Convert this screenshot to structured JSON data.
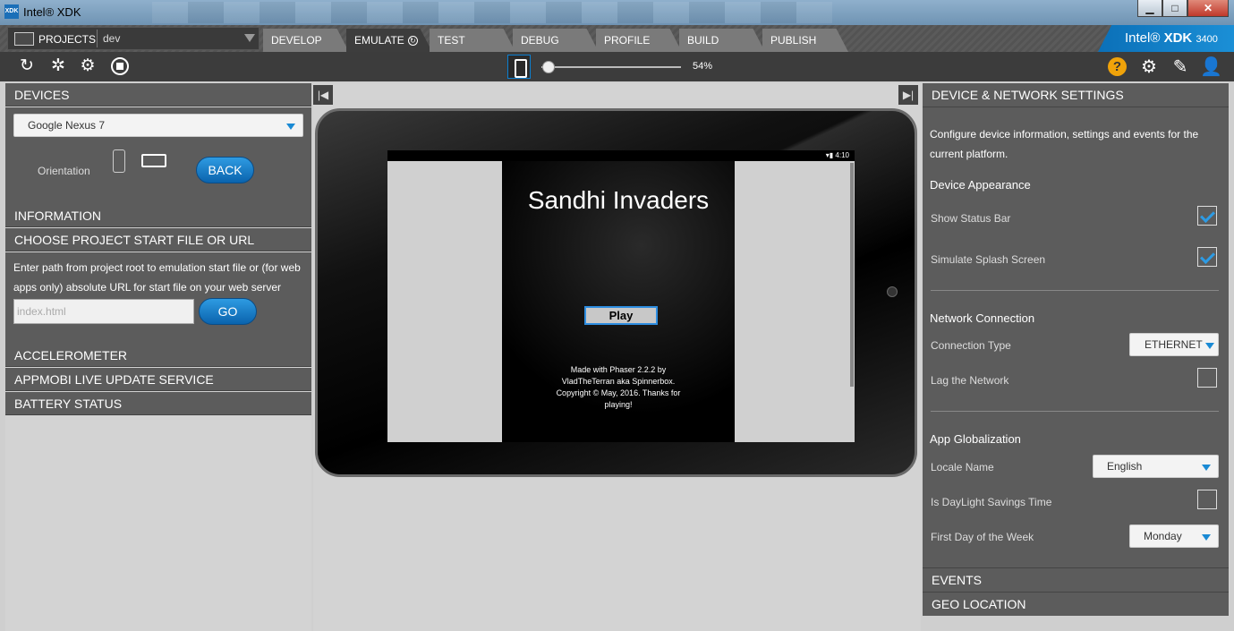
{
  "window": {
    "title": "Intel® XDK",
    "logo_text": "XDK",
    "minimize": "▁",
    "maximize": "□",
    "close": "✕"
  },
  "projects": {
    "label": "PROJECTS",
    "value": "dev"
  },
  "tabs": [
    {
      "label": "DEVELOP"
    },
    {
      "label": "EMULATE"
    },
    {
      "label": "TEST"
    },
    {
      "label": "DEBUG"
    },
    {
      "label": "PROFILE"
    },
    {
      "label": "BUILD"
    },
    {
      "label": "PUBLISH"
    }
  ],
  "brand": {
    "prefix": "Intel",
    "name": "XDK",
    "build": "3400"
  },
  "toolbar": {
    "zoom": "54%",
    "zoom_fraction": 0.54,
    "help": "?",
    "reload_icon": "↻",
    "debug_icon": "✲",
    "device_icon": "⚙",
    "gear_icon": "⚙",
    "feedback_icon": "✎",
    "user_icon": "👤"
  },
  "left": {
    "devices_header": "DEVICES",
    "device_selected": "Google Nexus 7",
    "orientation_label": "Orientation",
    "back_button": "BACK",
    "information_header": "INFORMATION",
    "start_file_header": "CHOOSE PROJECT START FILE OR URL",
    "start_file_help": "Enter path from project root to emulation start file or (for web apps only) absolute URL for start file on your web server",
    "start_file_placeholder": "index.html",
    "go_button": "GO",
    "accelerometer_header": "ACCELEROMETER",
    "appmobi_header": "APPMOBI LIVE UPDATE SERVICE",
    "battery_header": "BATTERY STATUS"
  },
  "center": {
    "collapse_left": "|◀",
    "collapse_right": "▶|"
  },
  "app": {
    "status_time": "4:10",
    "title": "Sandhi Invaders",
    "play": "Play",
    "credit": "Made with Phaser 2.2.2 by VladTheTerran aka Spinnerbox. Copyright © May, 2016. Thanks for playing!"
  },
  "right": {
    "header": "DEVICE & NETWORK SETTINGS",
    "intro": "Configure device information, settings and events for the current platform.",
    "appearance_title": "Device Appearance",
    "show_status_bar": "Show Status Bar",
    "show_status_bar_checked": true,
    "simulate_splash": "Simulate Splash Screen",
    "simulate_splash_checked": true,
    "network_title": "Network Connection",
    "connection_type_label": "Connection Type",
    "connection_type_value": "ETHERNET",
    "lag_label": "Lag the Network",
    "lag_checked": false,
    "globalization_title": "App Globalization",
    "locale_label": "Locale Name",
    "locale_value": "English",
    "dst_label": "Is DayLight Savings Time",
    "dst_checked": false,
    "first_day_label": "First Day of the Week",
    "first_day_value": "Monday",
    "events_header": "EVENTS",
    "geo_header": "GEO LOCATION"
  }
}
